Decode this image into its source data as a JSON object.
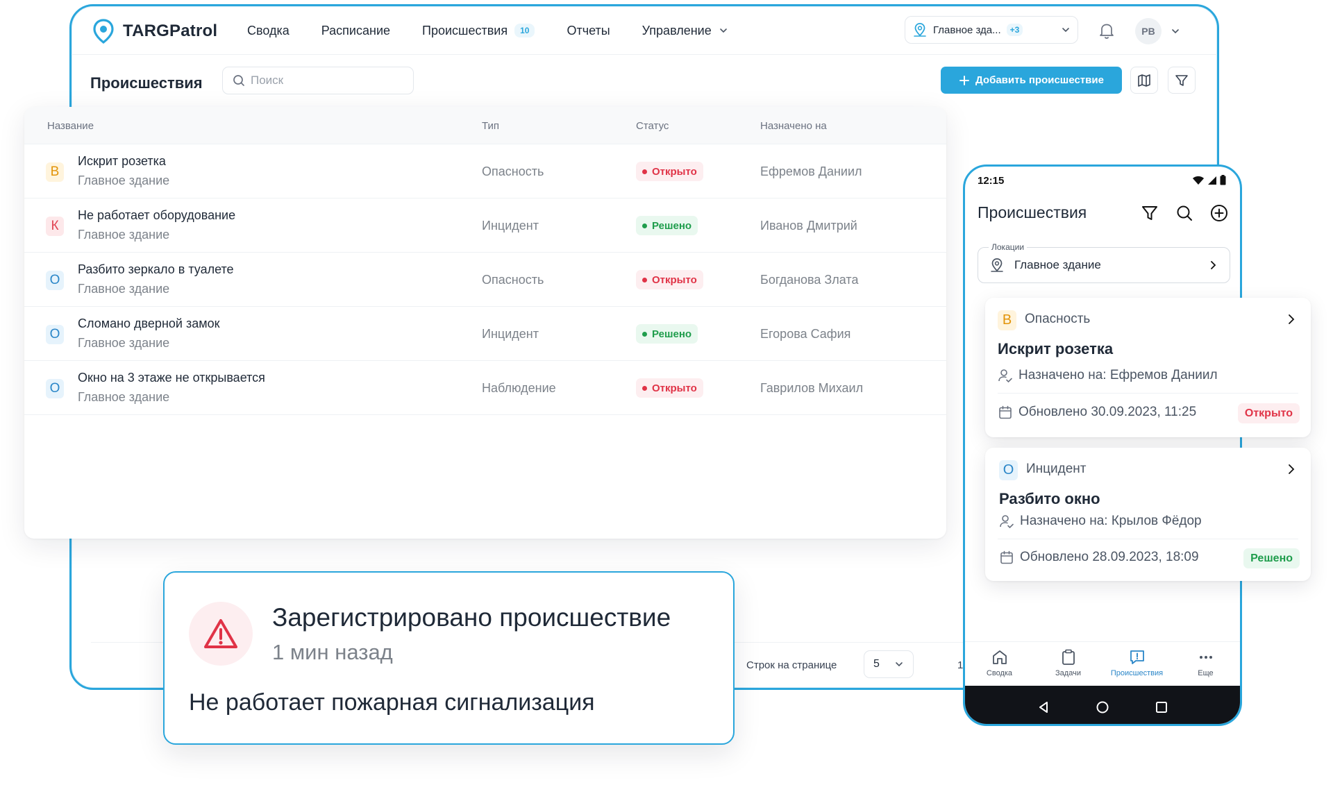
{
  "app": {
    "brand": "TARGPatrol",
    "nav": [
      {
        "label": "Сводка"
      },
      {
        "label": "Расписание"
      },
      {
        "label": "Происшествия",
        "badge": "10"
      },
      {
        "label": "Отчеты"
      },
      {
        "label": "Управление"
      }
    ],
    "location_select": {
      "value": "Главное зда...",
      "extra": "+3"
    },
    "avatar_initials": "РВ"
  },
  "page": {
    "title": "Происшествия",
    "search_placeholder": "Поиск",
    "add_button": "Добавить происшествие"
  },
  "table": {
    "columns": [
      "Название",
      "Тип",
      "Статус",
      "Назначено на"
    ],
    "rows": [
      {
        "priority": "В",
        "priority_class": "B",
        "title": "Искрит розетка",
        "location": "Главное здание",
        "type": "Опасность",
        "status": "Открыто",
        "status_class": "open",
        "assignee": "Ефремов Даниил"
      },
      {
        "priority": "К",
        "priority_class": "K",
        "title": "Не работает оборудование",
        "location": "Главное здание",
        "type": "Инцидент",
        "status": "Решено",
        "status_class": "done",
        "assignee": "Иванов Дмитрий"
      },
      {
        "priority": "О",
        "priority_class": "O",
        "title": "Разбито зеркало в туалете",
        "location": "Главное здание",
        "type": "Опасность",
        "status": "Открыто",
        "status_class": "open",
        "assignee": "Богданова Злата"
      },
      {
        "priority": "О",
        "priority_class": "O",
        "title": "Сломано дверной замок",
        "location": "Главное здание",
        "type": "Инцидент",
        "status": "Решено",
        "status_class": "done",
        "assignee": "Егорова Сафия"
      },
      {
        "priority": "О",
        "priority_class": "O",
        "title": "Окно на 3 этаже не открывается",
        "location": "Главное здание",
        "type": "Наблюдение",
        "status": "Открыто",
        "status_class": "open",
        "assignee": "Гаврилов Михаил"
      }
    ]
  },
  "pager": {
    "rows_label": "Строк на странице",
    "rows_value": "5",
    "page": "1"
  },
  "notification": {
    "title": "Зарегистрировано происшествие",
    "time": "1 мин назад",
    "message": "Не работает пожарная сигнализация"
  },
  "mobile": {
    "time": "12:15",
    "title": "Происшествия",
    "location_label": "Локации",
    "location_value": "Главное здание",
    "cards": [
      {
        "priority": "В",
        "priority_class": "B",
        "type": "Опасность",
        "title": "Искрит розетка",
        "assigned": "Назначено на: Ефремов Даниил",
        "updated": "Обновлено 30.09.2023, 11:25",
        "status": "Открыто",
        "status_class": "open"
      },
      {
        "priority": "О",
        "priority_class": "O",
        "type": "Инцидент",
        "title": "Разбито окно",
        "assigned": "Назначено на: Крылов Фёдор",
        "updated": "Обновлено 28.09.2023, 18:09",
        "status": "Решено",
        "status_class": "done"
      }
    ],
    "bottom_nav": [
      {
        "label": "Сводка",
        "icon": "home-icon"
      },
      {
        "label": "Задачи",
        "icon": "clipboard-icon"
      },
      {
        "label": "Происшествия",
        "icon": "incident-icon",
        "active": true
      },
      {
        "label": "Еще",
        "icon": "more-icon"
      }
    ]
  },
  "colors": {
    "accent": "#2aa6dc",
    "open": "#e03347",
    "done": "#1f9d4c"
  }
}
